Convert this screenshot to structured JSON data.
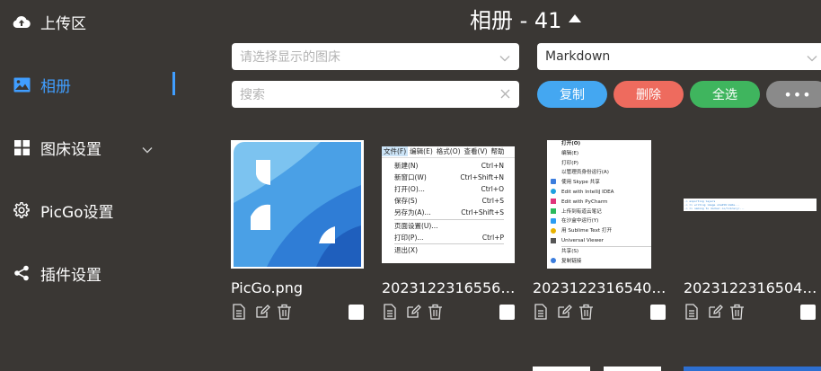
{
  "sidebar": {
    "items": [
      {
        "label": "上传区",
        "icon": "cloud-upload-icon"
      },
      {
        "label": "相册",
        "icon": "image-icon"
      },
      {
        "label": "图床设置",
        "icon": "grid-icon"
      },
      {
        "label": "PicGo设置",
        "icon": "gear-icon"
      },
      {
        "label": "插件设置",
        "icon": "share-icon"
      }
    ]
  },
  "gallery": {
    "title": "相册 - 41",
    "picbed_select_placeholder": "请选择显示的图床",
    "format_select_value": "Markdown",
    "search_placeholder": "搜索",
    "buttons": {
      "copy": "复制",
      "delete": "删除",
      "select_all": "全选",
      "more": "•••"
    },
    "items": [
      {
        "name": "PicGo.png"
      },
      {
        "name": "2023122316556…"
      },
      {
        "name": "2023122316540…"
      },
      {
        "name": "2023122316504…"
      }
    ],
    "notepad_menu": {
      "menubar": [
        "文件(F)",
        "编辑(E)",
        "格式(O)",
        "查看(V)",
        "帮助"
      ],
      "rows": [
        {
          "label": "新建(N)",
          "shortcut": "Ctrl+N"
        },
        {
          "label": "新窗口(W)",
          "shortcut": "Ctrl+Shift+N"
        },
        {
          "label": "打开(O)...",
          "shortcut": "Ctrl+O"
        },
        {
          "label": "保存(S)",
          "shortcut": "Ctrl+S"
        },
        {
          "label": "另存为(A)...",
          "shortcut": "Ctrl+Shift+S"
        },
        {
          "label": "页面设置(U)...",
          "shortcut": ""
        },
        {
          "label": "打印(P)...",
          "shortcut": "Ctrl+P"
        },
        {
          "label": "退出(X)",
          "shortcut": ""
        }
      ]
    },
    "context_menu": [
      "打开(O)",
      "编辑(E)",
      "打印(P)",
      "以管理员身份运行(A)",
      "使用 Skype 共享",
      "Edit with IntelliJ IDEA",
      "Edit with PyCharm",
      "上传到有道云笔记",
      "在沙盒中运行(Y)",
      "用 Sublime Text 打开",
      "Universal Viewer",
      "共享(S)",
      "复制链接"
    ],
    "code_lines": [
      "-> exporting layers",
      "-> => writing image sha256:2e6a...",
      "-> => naming to docker.io/library/..."
    ]
  },
  "colors": {
    "background": "#3a3734",
    "accent": "#409eff",
    "copy": "#44a7f1",
    "delete": "#ee6b5e",
    "select_all": "#3fb55e",
    "more": "#8a8a8a"
  }
}
